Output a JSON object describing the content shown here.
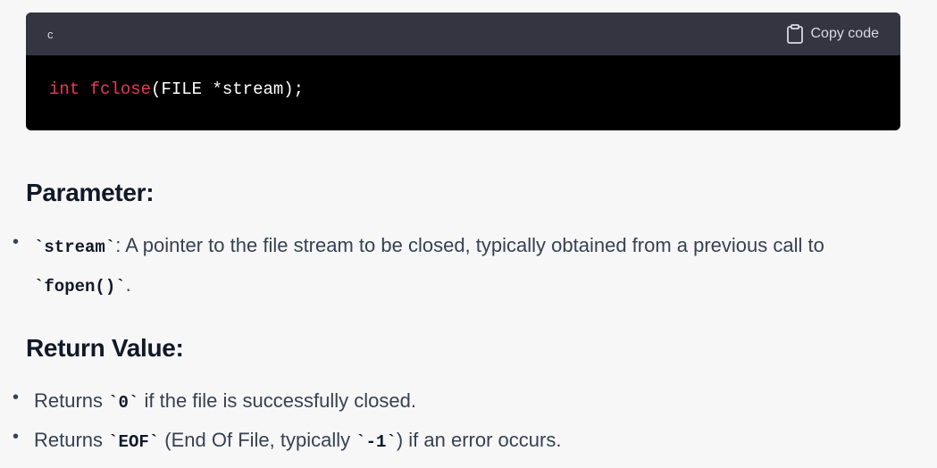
{
  "code_block": {
    "language": "c",
    "copy_label": "Copy code",
    "code": {
      "type": "int",
      "function": "fclose",
      "rest": "(FILE *stream);"
    }
  },
  "sections": {
    "parameter": {
      "heading": "Parameter:",
      "items": [
        {
          "code": "`stream`",
          "text": ": A pointer to the file stream to be closed, typically obtained from a previous call to",
          "code2": "`fopen()`",
          "text2": "."
        }
      ]
    },
    "return_value": {
      "heading": "Return Value:",
      "items": [
        {
          "pre": "Returns ",
          "code": "`0`",
          "post": " if the file is successfully closed."
        },
        {
          "pre": "Returns ",
          "code": "`EOF`",
          "mid": " (End Of File, typically ",
          "code2": "`-1`",
          "post": ") if an error occurs."
        }
      ]
    }
  },
  "colors": {
    "page_bg": "#f7f7f8",
    "code_header_bg": "#343541",
    "code_bg": "#000000",
    "keyword": "#e9385a"
  },
  "icons": [
    "clipboard-icon"
  ]
}
